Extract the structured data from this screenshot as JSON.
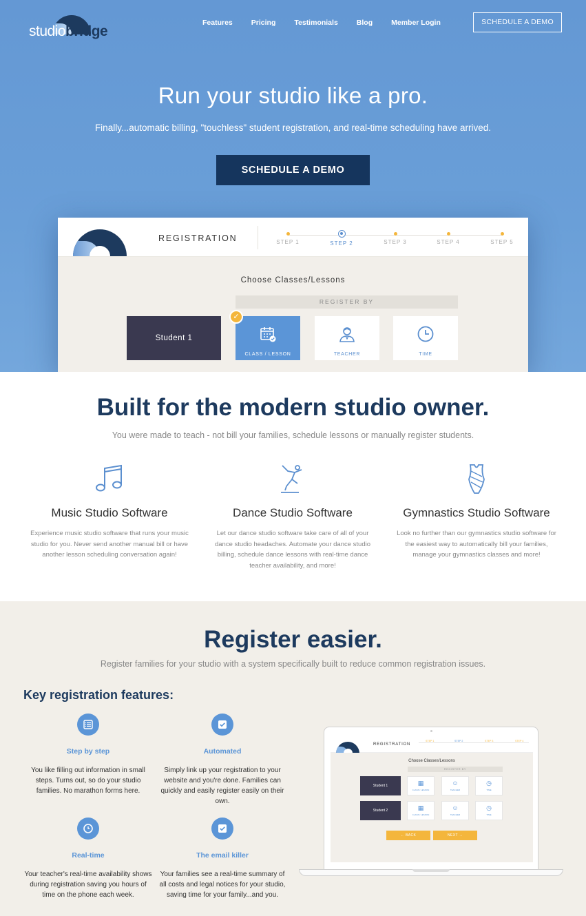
{
  "brand": {
    "logo_light": "studio",
    "logo_bold": "bridge"
  },
  "nav": {
    "items": [
      "Features",
      "Pricing",
      "Testimonials",
      "Blog",
      "Member Login"
    ],
    "cta": "SCHEDULE A DEMO"
  },
  "hero": {
    "title": "Run your studio like a pro.",
    "subtitle": "Finally...automatic billing, \"touchless\" student registration, and real-time scheduling have arrived.",
    "button": "SCHEDULE A DEMO"
  },
  "mockup": {
    "heading": "REGISTRATION",
    "steps": [
      "STEP 1",
      "STEP 2",
      "STEP 3",
      "STEP 4",
      "STEP 5"
    ],
    "choose": "Choose Classes/Lessons",
    "register_by": "REGISTER BY",
    "student": "Student 1",
    "options": [
      {
        "label": "CLASS / LESSON",
        "icon": "calendar-icon",
        "selected": true
      },
      {
        "label": "TEACHER",
        "icon": "teacher-icon",
        "selected": false
      },
      {
        "label": "TIME",
        "icon": "clock-icon",
        "selected": false
      }
    ]
  },
  "modern": {
    "title": "Built for the modern studio owner.",
    "subtitle": "You were made to teach - not bill your families, schedule lessons or manually register students.",
    "features": [
      {
        "icon": "music-note-icon",
        "title": "Music Studio Software",
        "text": "Experience music studio software that runs your music studio for you. Never send another manual bill or have another lesson scheduling conversation again!"
      },
      {
        "icon": "dancer-icon",
        "title": "Dance Studio Software",
        "text": "Let our dance studio software take care of all of your dance studio headaches. Automate your dance studio billing, schedule dance lessons with real-time dance teacher availability, and more!"
      },
      {
        "icon": "leotard-icon",
        "title": "Gymnastics Studio Software",
        "text": "Look no further than our gymnastics studio software for the easiest way to automatically bill your families, manage your gymnastics classes and more!"
      }
    ]
  },
  "register": {
    "title": "Register easier.",
    "subtitle": "Register families for your studio with a system specifically built to reduce common registration issues.",
    "key_heading": "Key registration features:",
    "features": [
      {
        "icon": "list-icon",
        "title": "Step by step",
        "text": "You like filling out information in small steps. Turns out, so do your studio families. No marathon forms here."
      },
      {
        "icon": "check-icon",
        "title": "Automated",
        "text": "Simply link up your registration to your website and you're done. Families can quickly and easily register easily on their own."
      },
      {
        "icon": "clock-icon",
        "title": "Real-time",
        "text": "Your teacher's real-time availability shows during registration saving you hours of time on the phone each week."
      },
      {
        "icon": "check-icon",
        "title": "The email killer",
        "text": "Your families see a real-time summary of all costs and legal notices for your studio, saving time for your family...and you."
      }
    ],
    "laptop": {
      "heading": "REGISTRATION",
      "choose": "Choose Classes/Lessons",
      "register_by": "REGISTER BY",
      "students": [
        "Student 1",
        "Student 2"
      ],
      "options": [
        "CLASS / LESSON",
        "TEACHER",
        "TIME"
      ],
      "back": "← BACK",
      "next": "NEXT →"
    }
  },
  "colors": {
    "hero": "#6a9fd8",
    "navy": "#1d3a5e",
    "accent": "#5b95d7",
    "gold": "#f4b63c",
    "sand": "#f2efe9"
  }
}
